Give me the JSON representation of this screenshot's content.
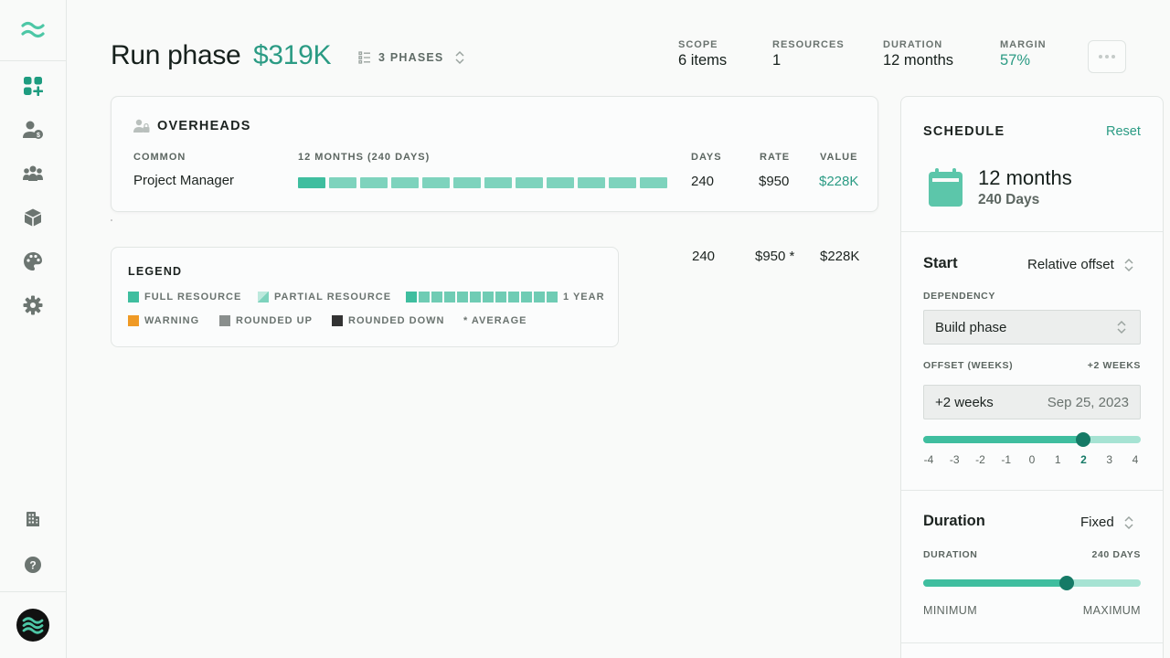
{
  "sidebar": {
    "items": [
      {
        "icon": "dashboard-add-icon"
      },
      {
        "icon": "user-billing-icon"
      },
      {
        "icon": "team-icon"
      },
      {
        "icon": "cube-icon"
      },
      {
        "icon": "palette-icon"
      },
      {
        "icon": "gear-icon"
      }
    ],
    "bottom_items": [
      {
        "icon": "building-icon"
      },
      {
        "icon": "help-icon"
      }
    ]
  },
  "header": {
    "title": "Run phase",
    "total": "$319K",
    "phases_label": "3 PHASES",
    "stats": [
      {
        "label": "SCOPE",
        "value": "6 items"
      },
      {
        "label": "RESOURCES",
        "value": "1"
      },
      {
        "label": "DURATION",
        "value": "12 months"
      },
      {
        "label": "MARGIN",
        "value": "57%"
      }
    ]
  },
  "overheads": {
    "title": "OVERHEADS",
    "columns": {
      "common": "COMMON",
      "timeline": "12 MONTHS (240 DAYS)",
      "days": "DAYS",
      "rate": "RATE",
      "value": "VALUE"
    },
    "rows": [
      {
        "name": "Project Manager",
        "months": 12,
        "days": "240",
        "rate": "$950",
        "value": "$228K"
      }
    ]
  },
  "summary": {
    "days": "240",
    "rate": "$950 *",
    "value": "$228K"
  },
  "legend": {
    "title": "LEGEND",
    "full_resource": "FULL RESOURCE",
    "partial_resource": "PARTIAL RESOURCE",
    "one_year": "1 YEAR",
    "warning": "WARNING",
    "rounded_up": "ROUNDED UP",
    "rounded_down": "ROUNDED DOWN",
    "average": "* AVERAGE"
  },
  "schedule": {
    "title": "SCHEDULE",
    "reset_label": "Reset",
    "duration_main": "12 months",
    "duration_days": "240 Days",
    "start": {
      "title": "Start",
      "mode": "Relative offset",
      "dependency_label": "DEPENDENCY",
      "dependency_value": "Build phase",
      "offset_label": "OFFSET (WEEKS)",
      "offset_readout": "+2 WEEKS",
      "offset_value": "+2 weeks",
      "offset_date": "Sep 25, 2023",
      "slider_min": -4,
      "slider_max": 4,
      "slider_value": 2,
      "ticks": [
        "-4",
        "-3",
        "-2",
        "-1",
        "0",
        "1",
        "2",
        "3",
        "4"
      ]
    },
    "duration": {
      "title": "Duration",
      "mode": "Fixed",
      "label": "DURATION",
      "readout": "240 DAYS",
      "slider_fraction": 0.66,
      "min_label": "MINIMUM",
      "max_label": "MAXIMUM"
    }
  },
  "colors": {
    "accent": "#2b9b84",
    "full_resource": "#3fbe9f",
    "partial_resource": "#7ed3bd",
    "warning": "#ef9a25",
    "rounded_up": "#8a8f8d",
    "rounded_down": "#333333",
    "slider_knob": "#157a66"
  }
}
